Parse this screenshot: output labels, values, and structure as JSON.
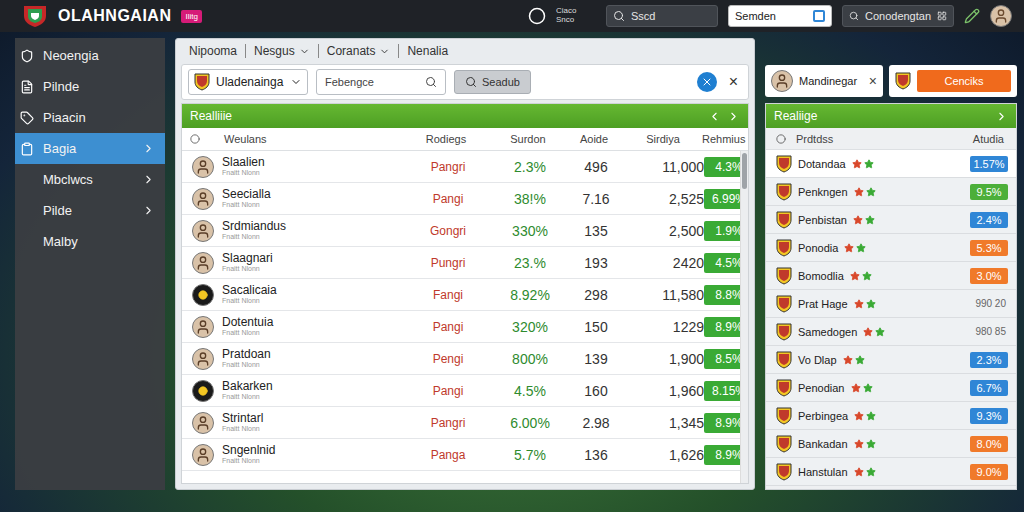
{
  "app": {
    "title": "OLAHNGAIAN",
    "badge": "Ilitg",
    "center_label": "Ciaco Snco"
  },
  "top_search": [
    {
      "label": "Sscd",
      "kind": "dark"
    },
    {
      "label": "Semden",
      "kind": "light"
    },
    {
      "label": "Conodengtan",
      "kind": "dark"
    }
  ],
  "sidebar": {
    "items": [
      {
        "label": "Neoengia",
        "kind": "icon",
        "selected": false,
        "has_submenu": false
      },
      {
        "label": "Pilnde",
        "kind": "icon",
        "selected": false,
        "has_submenu": false
      },
      {
        "label": "Piaacin",
        "kind": "icon",
        "selected": false,
        "has_submenu": false
      },
      {
        "label": "Bagia",
        "kind": "icon",
        "selected": true,
        "has_submenu": true
      },
      {
        "label": "Mbclwcs",
        "kind": "text",
        "selected": false,
        "has_submenu": true
      },
      {
        "label": "Pilde",
        "kind": "text",
        "selected": false,
        "has_submenu": true
      },
      {
        "label": "Malby",
        "kind": "text",
        "selected": false,
        "has_submenu": false
      }
    ]
  },
  "breadcrumb": [
    {
      "label": "Nipooma",
      "dropdown": false
    },
    {
      "label": "Nesgus",
      "dropdown": true
    },
    {
      "label": "Coranats",
      "dropdown": true
    },
    {
      "label": "Nenalia",
      "dropdown": false
    }
  ],
  "filters": {
    "team": "Uladenainga",
    "search": "Febengce",
    "button": "Seadub",
    "close": "×"
  },
  "table": {
    "title": "Realliiie",
    "columns": [
      "Weulans",
      "Rodiegs",
      "Surdon",
      "Aoide",
      "Sirdiya",
      "Rehmius"
    ],
    "rows": [
      {
        "kind": "person",
        "name": "Slaalien",
        "subtitle": "Fnaitt Nlonn",
        "position": "Pangri",
        "share": "2.3%",
        "value_a": "496",
        "value_b": "11,000",
        "rating": "4.3%"
      },
      {
        "kind": "person",
        "name": "Seecialla",
        "subtitle": "Fnaitt Nlonn",
        "position": "Pangi",
        "share": "38!%",
        "value_a": "7.16",
        "value_b": "2,525",
        "rating": "6.99%"
      },
      {
        "kind": "person",
        "name": "Srdmiandus",
        "subtitle": "Fnaitt Nlonn",
        "position": "Gongri",
        "share": "330%",
        "value_a": "135",
        "value_b": "2,500",
        "rating": "1.9%"
      },
      {
        "kind": "person",
        "name": "Slaagnari",
        "subtitle": "Fnaitt Nlonn",
        "position": "Pungri",
        "share": "23.%",
        "value_a": "193",
        "value_b": "2420",
        "rating": "4.5%"
      },
      {
        "kind": "crest",
        "name": "Sacalicaia",
        "subtitle": "Fnaitt Nlonn",
        "position": "Fangi",
        "share": "8.92%",
        "value_a": "298",
        "value_b": "11,580",
        "rating": "8.8%"
      },
      {
        "kind": "person",
        "name": "Dotentuia",
        "subtitle": "Fnaitt Nlonn",
        "position": "Pangi",
        "share": "320%",
        "value_a": "150",
        "value_b": "1229",
        "rating": "8.9%"
      },
      {
        "kind": "person",
        "name": "Pratdoan",
        "subtitle": "Fnaitt Nlonn",
        "position": "Pengi",
        "share": "800%",
        "value_a": "139",
        "value_b": "1,900",
        "rating": "8.5%"
      },
      {
        "kind": "crest",
        "name": "Bakarken",
        "subtitle": "Fnaitt Nlonn",
        "position": "Pangi",
        "share": "4.5%",
        "value_a": "160",
        "value_b": "1,960",
        "rating": "8.15%"
      },
      {
        "kind": "person",
        "name": "Strintarl",
        "subtitle": "Fnaitt Nlonn",
        "position": "Pangri",
        "share": "6.00%",
        "value_a": "2.98",
        "value_b": "1,345",
        "rating": "8.9%"
      },
      {
        "kind": "person",
        "name": "Sngenlnid",
        "subtitle": "Fnaitt Nlonn",
        "position": "Panga",
        "share": "5.7%",
        "value_a": "136",
        "value_b": "1,626",
        "rating": "8.9%"
      }
    ]
  },
  "right": {
    "chip": "Mandinegar",
    "chip_close": "×",
    "button": "Cenciks",
    "panel": {
      "title": "Realiige",
      "columns": [
        "Prdtdss",
        "Atudia"
      ],
      "rows": [
        {
          "name": "Dotandaa",
          "value": "1.57%",
          "kind": "badge",
          "color": "#2f86d6",
          "selected": true
        },
        {
          "name": "Penkngen",
          "value": "9.5%",
          "kind": "badge",
          "color": "#4caf3a",
          "selected": false
        },
        {
          "name": "Penbistan",
          "value": "2.4%",
          "kind": "badge",
          "color": "#2f86d6",
          "selected": false
        },
        {
          "name": "Ponodia",
          "value": "5.3%",
          "kind": "badge",
          "color": "#f07a2a",
          "selected": false
        },
        {
          "name": "Bomodlia",
          "value": "3.0%",
          "kind": "badge",
          "color": "#f07a2a",
          "selected": false
        },
        {
          "name": "Prat Hage",
          "value": "990 20",
          "kind": "plain",
          "color": "#666666",
          "selected": false
        },
        {
          "name": "Samedogen",
          "value": "980 85",
          "kind": "plain",
          "color": "#666666",
          "selected": false
        },
        {
          "name": "Vo Dlap",
          "value": "2.3%",
          "kind": "badge",
          "color": "#2f86d6",
          "selected": false
        },
        {
          "name": "Penodian",
          "value": "6.7%",
          "kind": "badge",
          "color": "#2f86d6",
          "selected": false
        },
        {
          "name": "Perbingea",
          "value": "9.3%",
          "kind": "badge",
          "color": "#2f86d6",
          "selected": false
        },
        {
          "name": "Bankadan",
          "value": "8.0%",
          "kind": "badge",
          "color": "#f07a2a",
          "selected": false
        },
        {
          "name": "Hanstulan",
          "value": "9.0%",
          "kind": "badge",
          "color": "#f07a2a",
          "selected": false
        }
      ]
    }
  }
}
